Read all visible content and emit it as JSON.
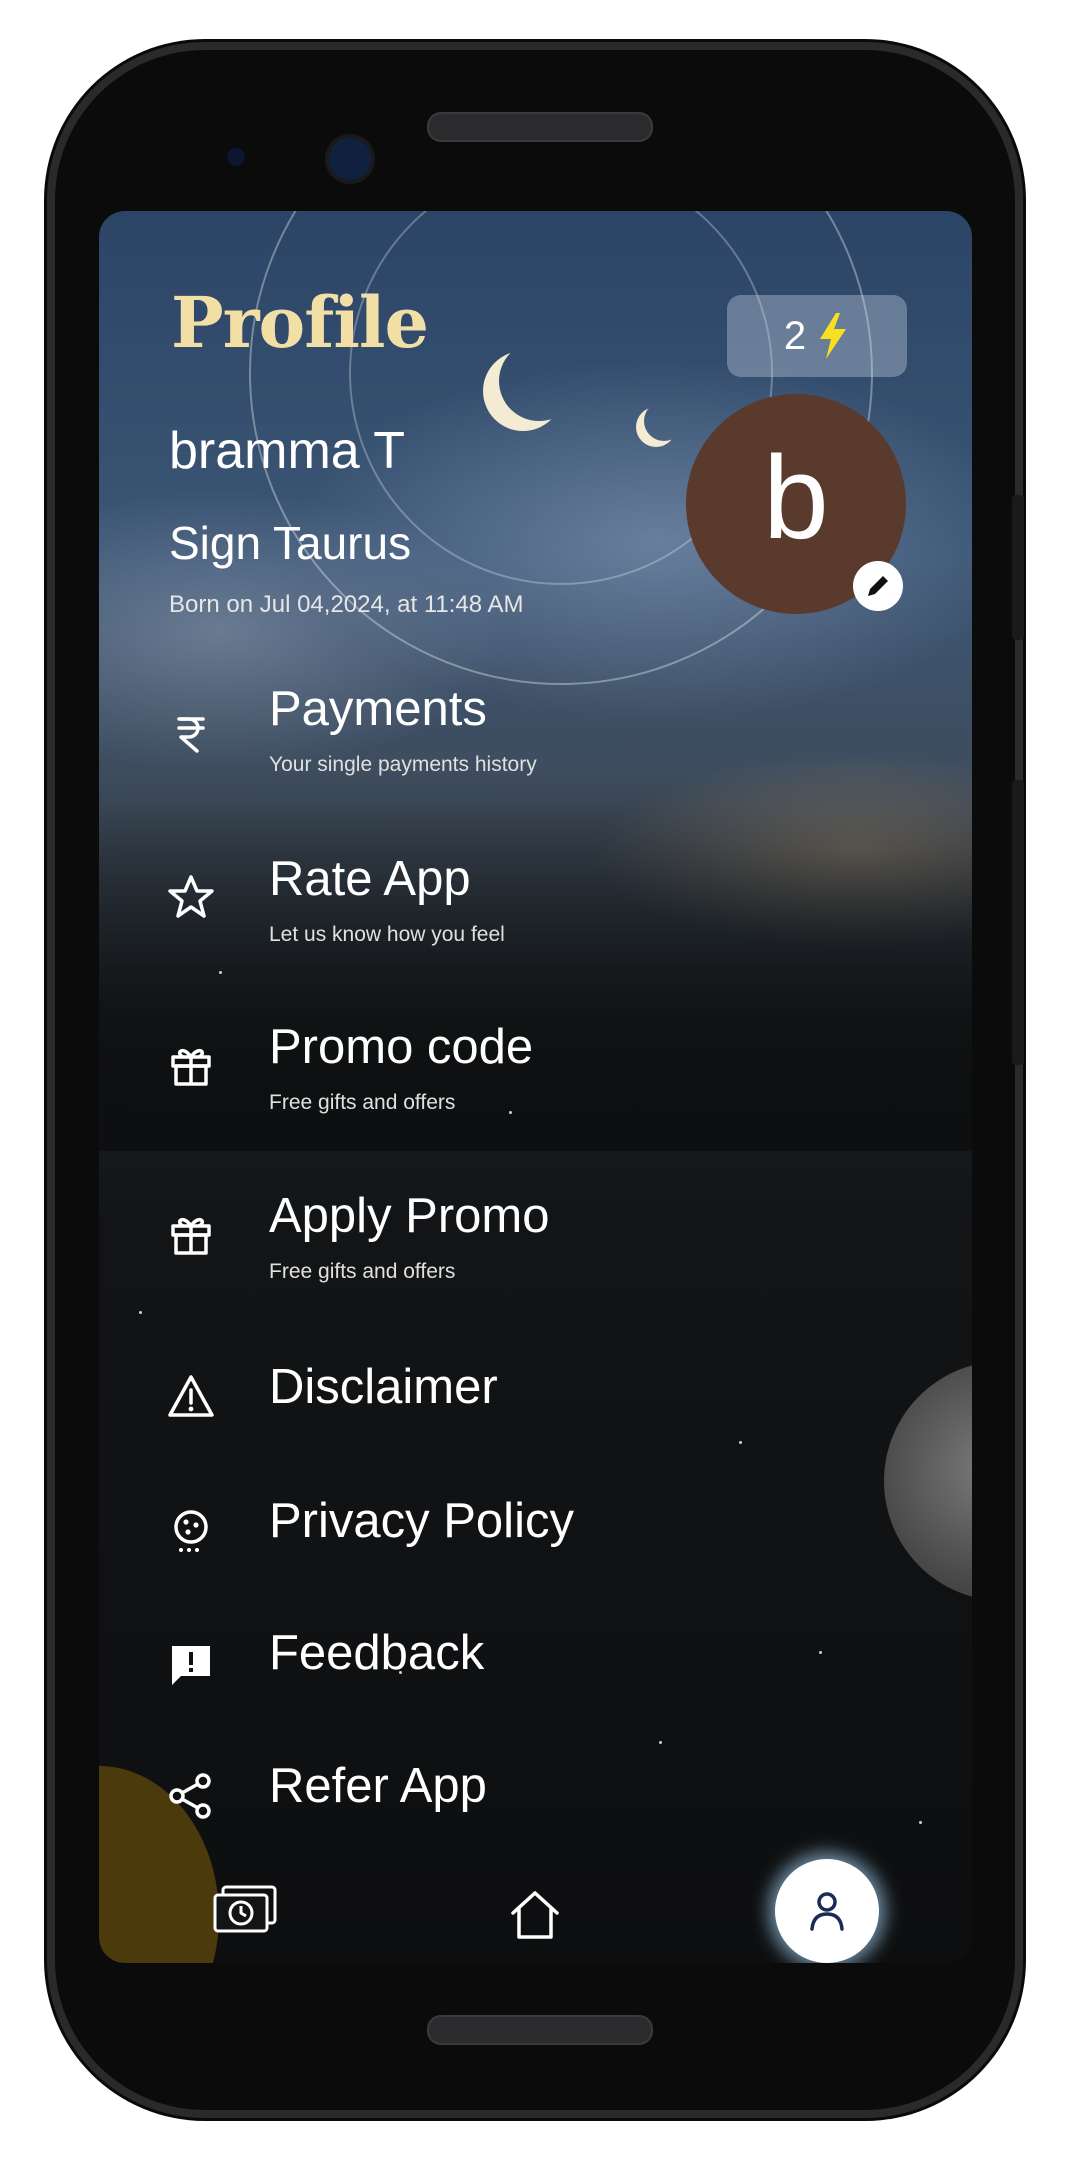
{
  "header": {
    "title": "Profile",
    "credits": {
      "count": "2",
      "icon": "lightning-bolt-icon",
      "icon_color": "#f7e020"
    }
  },
  "user": {
    "name": "bramma T",
    "sign": "Sign Taurus",
    "born": "Born on Jul 04,2024, at 11:48 AM",
    "avatar_letter": "b",
    "avatar_color": "#5b3a2e"
  },
  "menu": [
    {
      "label": "Payments",
      "subtitle": "Your single payments history",
      "icon": "rupee-icon"
    },
    {
      "label": "Rate App",
      "subtitle": "Let us know how you feel",
      "icon": "star-icon"
    },
    {
      "label": "Promo code",
      "subtitle": "Free gifts and offers",
      "icon": "gift-icon"
    },
    {
      "label": "Apply Promo",
      "subtitle": "Free gifts and offers",
      "icon": "gift-icon"
    },
    {
      "label": "Disclaimer",
      "icon": "warning-icon"
    },
    {
      "label": "Privacy Policy",
      "icon": "cookie-icon"
    },
    {
      "label": "Feedback",
      "icon": "feedback-icon"
    },
    {
      "label": "Refer App",
      "icon": "share-icon"
    }
  ],
  "bottom_nav": [
    {
      "name": "payments-history",
      "icon": "money-clock-icon"
    },
    {
      "name": "home",
      "icon": "home-icon"
    },
    {
      "name": "profile",
      "icon": "user-icon",
      "active": true
    }
  ],
  "colors": {
    "title": "#f2dfa6",
    "accent_glow": "#aadcff"
  }
}
